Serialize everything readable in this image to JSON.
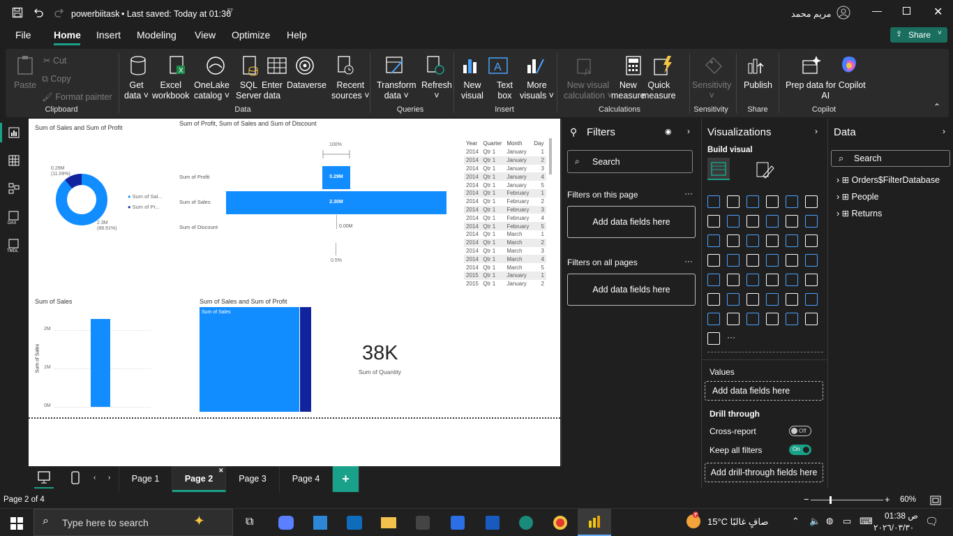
{
  "titlebar": {
    "file_name": "powerbiitask",
    "saved": "• Last saved: Today at 01:36",
    "user_name": "مريم محمد"
  },
  "menu": {
    "items": [
      "File",
      "Home",
      "Insert",
      "Modeling",
      "View",
      "Optimize",
      "Help"
    ],
    "share": "Share"
  },
  "ribbon": {
    "clipboard": {
      "paste": "Paste",
      "cut": "Cut",
      "copy": "Copy",
      "format_painter": "Format painter",
      "group": "Clipboard"
    },
    "data": {
      "get_data": "Get\ndata ˅",
      "excel": "Excel\nworkbook",
      "onelake": "OneLake\ncatalog ˅",
      "sql": "SQL\nServer",
      "enter_data": "Enter\ndata",
      "dataverse": "Dataverse",
      "recent": "Recent\nsources ˅",
      "group": "Data"
    },
    "queries": {
      "transform": "Transform\ndata ˅",
      "refresh": "Refresh\n˅",
      "group": "Queries"
    },
    "insert": {
      "new_visual": "New\nvisual",
      "text_box": "Text\nbox",
      "more_visuals": "More\nvisuals ˅",
      "group": "Insert"
    },
    "calculations": {
      "new_visual_calc": "New visual\ncalculation ˅",
      "new_measure": "New\nmeasure",
      "quick_measure": "Quick\nmeasure",
      "group": "Calculations"
    },
    "sensitivity": {
      "label": "Sensitivity\n˅",
      "group": "Sensitivity"
    },
    "share": {
      "publish": "Publish",
      "group": "Share"
    },
    "copilot": {
      "prep": "Prep data for Copilot\nAI",
      "group": "Copilot"
    }
  },
  "canvas": {
    "donut": {
      "title": "Sum of Sales and Sum of Profit",
      "label_profit": "0.29M\n(11.09%)",
      "label_sales": "2.3M\n(88.91%)",
      "legend": [
        "Sum of Sal...",
        "Sum of Pr..."
      ]
    },
    "funnel": {
      "title": "Sum of Profit, Sum of Sales and Sum of Discount",
      "top_pct": "100%",
      "bottom_pct": "0.5%",
      "rows": [
        {
          "label": "Sum of Profit",
          "value": "0.29M"
        },
        {
          "label": "Sum of Sales",
          "value": "2.30M"
        },
        {
          "label": "Sum of Discount",
          "value": "0.00M"
        }
      ]
    },
    "table": {
      "headers": [
        "Year",
        "Quarter",
        "Month",
        "Day"
      ],
      "rows": [
        [
          "2014",
          "Qtr 1",
          "January",
          "1"
        ],
        [
          "2014",
          "Qtr 1",
          "January",
          "2"
        ],
        [
          "2014",
          "Qtr 1",
          "January",
          "3"
        ],
        [
          "2014",
          "Qtr 1",
          "January",
          "4"
        ],
        [
          "2014",
          "Qtr 1",
          "January",
          "5"
        ],
        [
          "2014",
          "Qtr 1",
          "February",
          "1"
        ],
        [
          "2014",
          "Qtr 1",
          "February",
          "2"
        ],
        [
          "2014",
          "Qtr 1",
          "February",
          "3"
        ],
        [
          "2014",
          "Qtr 1",
          "February",
          "4"
        ],
        [
          "2014",
          "Qtr 1",
          "February",
          "5"
        ],
        [
          "2014",
          "Qtr 1",
          "March",
          "1"
        ],
        [
          "2014",
          "Qtr 1",
          "March",
          "2"
        ],
        [
          "2014",
          "Qtr 1",
          "March",
          "3"
        ],
        [
          "2014",
          "Qtr 1",
          "March",
          "4"
        ],
        [
          "2014",
          "Qtr 1",
          "March",
          "5"
        ],
        [
          "2015",
          "Qtr 1",
          "January",
          "1"
        ],
        [
          "2015",
          "Qtr 1",
          "January",
          "2"
        ]
      ]
    },
    "column": {
      "title": "Sum of Sales",
      "ylabel": "Sum of Sales",
      "ticks": [
        "2M",
        "1M",
        "0M"
      ]
    },
    "treemap": {
      "title": "Sum of Sales and Sum of Profit",
      "label": "Sum of Sales"
    },
    "card": {
      "value": "38K",
      "label": "Sum of Quantity"
    }
  },
  "chart_data": [
    {
      "type": "pie",
      "title": "Sum of Sales and Sum of Profit",
      "categories": [
        "Sum of Sales",
        "Sum of Profit"
      ],
      "values": [
        2.3,
        0.29
      ],
      "unit": "M",
      "legend_position": "right"
    },
    {
      "type": "bar",
      "title": "Sum of Profit, Sum of Sales and Sum of Discount",
      "categories": [
        "Sum of Profit",
        "Sum of Sales",
        "Sum of Discount"
      ],
      "values": [
        0.29,
        2.3,
        0.0
      ],
      "unit": "M"
    },
    {
      "type": "bar",
      "title": "Sum of Sales",
      "ylabel": "Sum of Sales",
      "values": [
        2.3
      ],
      "ylim": [
        0,
        2.5
      ],
      "unit": "M"
    }
  ],
  "filters": {
    "title": "Filters",
    "search_placeholder": "Search",
    "on_this_page": "Filters on this page",
    "on_all_pages": "Filters on all pages",
    "add_fields": "Add data fields here"
  },
  "visualizations": {
    "title": "Visualizations",
    "build_visual": "Build visual",
    "values": "Values",
    "add_fields": "Add data fields here",
    "drill_through": "Drill through",
    "cross_report": "Cross-report",
    "cross_toggle": "Off",
    "keep_filters": "Keep all filters",
    "keep_toggle": "On",
    "add_drill": "Add drill-through fields here"
  },
  "data_pane": {
    "title": "Data",
    "search_placeholder": "Search",
    "tables": [
      "Orders$FilterDatabase",
      "People",
      "Returns"
    ]
  },
  "pages": {
    "tabs": [
      "Page 1",
      "Page 2",
      "Page 3",
      "Page 4"
    ],
    "add": "+"
  },
  "status": {
    "page_info": "Page 2 of 4",
    "zoom": "60%"
  },
  "taskbar": {
    "search_placeholder": "Type here to search",
    "weather": "15°C  صافٍ غالبًا",
    "time": "01:38 ص",
    "date": "٢٠٢٦/٠٣/٣٠",
    "badge": "٣"
  },
  "colors": {
    "accent_teal": "#1aa189",
    "bar_blue": "#118dff",
    "dark_blue": "#12239e"
  }
}
